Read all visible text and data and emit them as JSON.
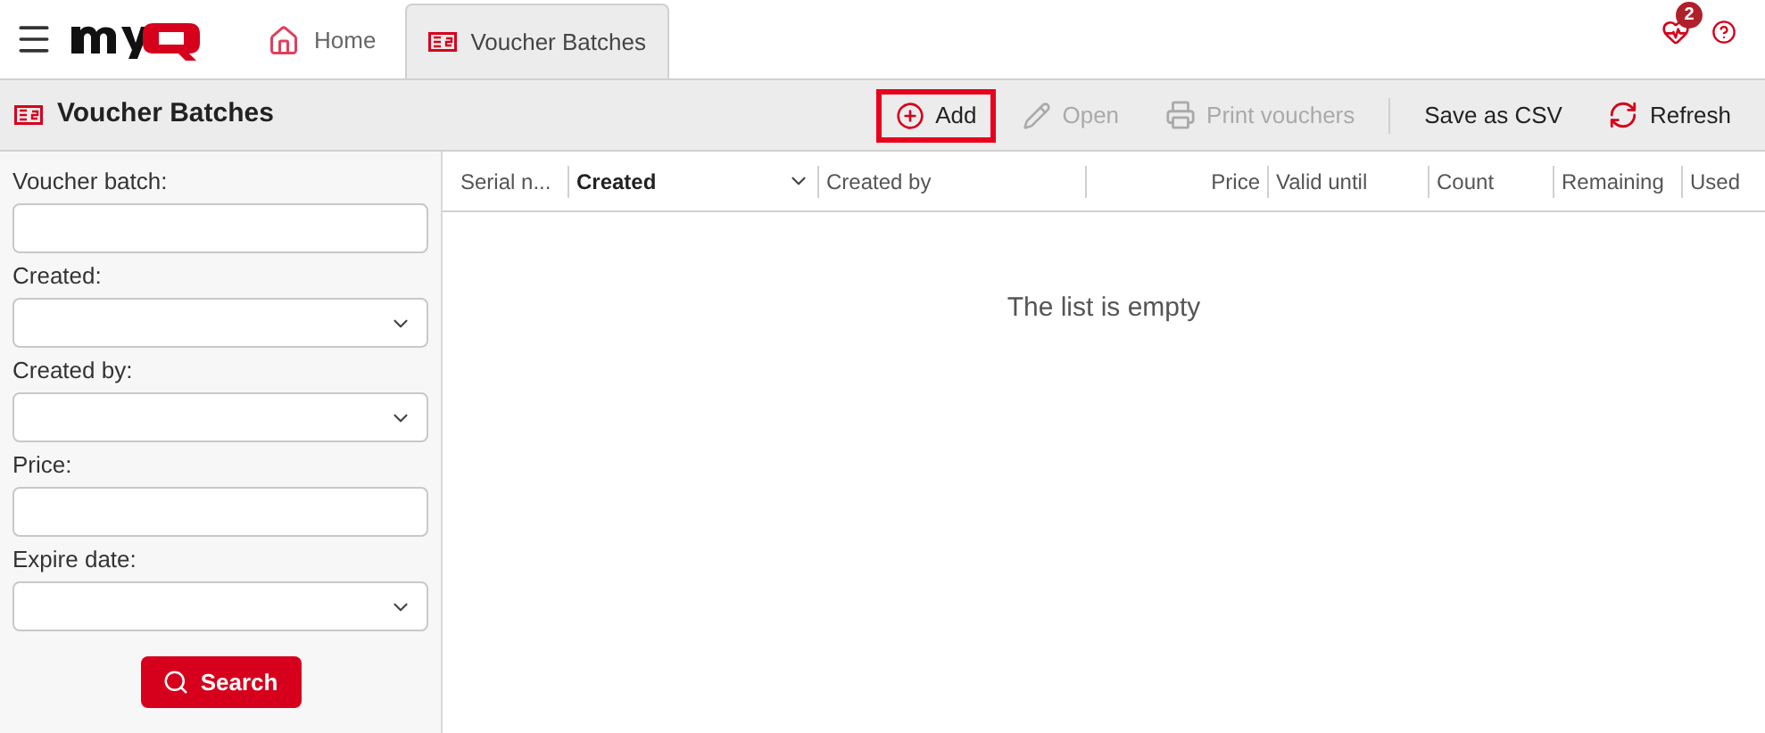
{
  "header": {
    "notification_count": "2"
  },
  "tabs": [
    {
      "label": "Home",
      "kind": "home",
      "selected": false
    },
    {
      "label": "Voucher Batches",
      "kind": "voucher",
      "selected": true
    }
  ],
  "page_title": "Voucher Batches",
  "toolbar": [
    {
      "label": "Add",
      "kind": "add",
      "disabled": false,
      "highlighted": true
    },
    {
      "label": "Open",
      "kind": "open",
      "disabled": true,
      "highlighted": false
    },
    {
      "label": "Print vouchers",
      "kind": "print",
      "disabled": true,
      "highlighted": false
    },
    {
      "label": "Save as CSV",
      "kind": "csv",
      "disabled": false,
      "highlighted": false
    },
    {
      "label": "Refresh",
      "kind": "refresh",
      "disabled": false,
      "highlighted": false
    }
  ],
  "filters": [
    {
      "label": "Voucher batch:",
      "kind": "text"
    },
    {
      "label": "Created:",
      "kind": "select"
    },
    {
      "label": "Created by:",
      "kind": "select"
    },
    {
      "label": "Price:",
      "kind": "text"
    },
    {
      "label": "Expire date:",
      "kind": "select"
    }
  ],
  "search_button": "Search",
  "table": {
    "columns": [
      {
        "label": "Serial n...",
        "sorted": false
      },
      {
        "label": "Created",
        "sorted": true
      },
      {
        "label": "Created by",
        "sorted": false
      },
      {
        "label": "Price",
        "sorted": false
      },
      {
        "label": "Valid until",
        "sorted": false
      },
      {
        "label": "Count",
        "sorted": false
      },
      {
        "label": "Remaining",
        "sorted": false
      },
      {
        "label": "Used",
        "sorted": false
      }
    ],
    "empty_message": "The list is empty"
  }
}
